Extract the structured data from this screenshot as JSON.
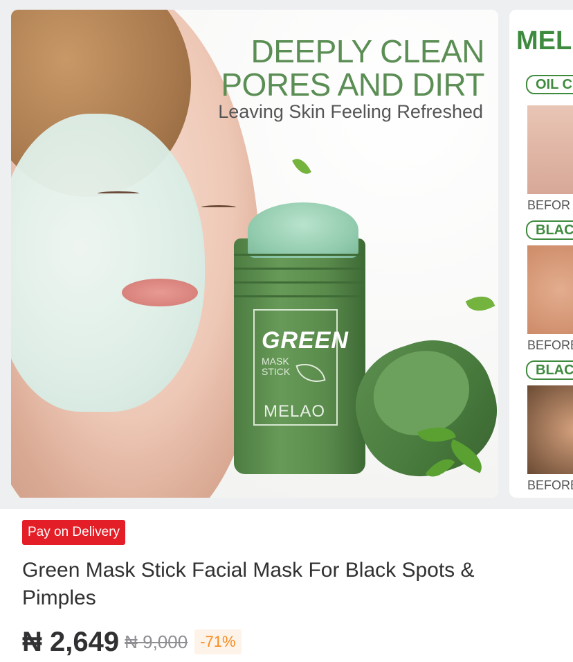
{
  "gallery": {
    "main_image": {
      "headline_line1": "DEEPLY CLEAN",
      "headline_line2": "PORES AND DIRT",
      "subline": "Leaving Skin Feeling Refreshed",
      "pack_green": "GREEN",
      "pack_mask": "MASK",
      "pack_stick": "STICK",
      "pack_brand": "MELAO"
    },
    "next_image": {
      "title": "MEL",
      "tag1": "OIL C",
      "tag2": "BLAC",
      "tag3": "BLAC",
      "caption1": "BEFOR",
      "caption2": "BEFORE",
      "caption3": "BEFORE"
    }
  },
  "product": {
    "badge": "Pay on Delivery",
    "title": "Green Mask Stick Facial Mask For Black Spots & Pimples",
    "price": "₦ 2,649",
    "old_price": "₦ 9,000",
    "discount": "-71%"
  },
  "colors": {
    "badge_bg": "#e41e26",
    "discount_text": "#f68b1e",
    "discount_bg": "#fef3e9",
    "brand_green": "#5b8e54"
  }
}
